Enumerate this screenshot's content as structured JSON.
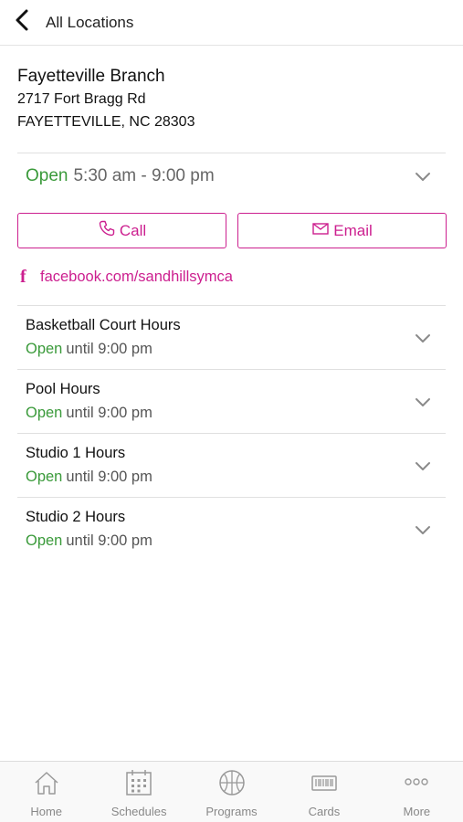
{
  "header": {
    "back_label": "All Locations"
  },
  "branch": {
    "name": "Fayetteville Branch",
    "address_line1": "2717 Fort Bragg Rd",
    "address_line2": "FAYETTEVILLE, NC 28303"
  },
  "hours": {
    "status": "Open",
    "range": "5:30 am - 9:00 pm"
  },
  "actions": {
    "call_label": "Call",
    "email_label": "Email"
  },
  "social": {
    "facebook_icon": "f",
    "facebook_text": "facebook.com/sandhillsymca"
  },
  "facilities": [
    {
      "name": "Basketball Court Hours",
      "status": "Open",
      "detail": "until 9:00 pm"
    },
    {
      "name": "Pool Hours",
      "status": "Open",
      "detail": "until 9:00 pm"
    },
    {
      "name": "Studio 1 Hours",
      "status": "Open",
      "detail": "until 9:00 pm"
    },
    {
      "name": "Studio 2 Hours",
      "status": "Open",
      "detail": "until 9:00 pm"
    }
  ],
  "tabbar": [
    {
      "label": "Home",
      "icon": "home-icon"
    },
    {
      "label": "Schedules",
      "icon": "calendar-icon"
    },
    {
      "label": "Programs",
      "icon": "basketball-icon"
    },
    {
      "label": "Cards",
      "icon": "card-icon"
    },
    {
      "label": "More",
      "icon": "more-icon"
    }
  ],
  "colors": {
    "accent": "#cc1f8f",
    "open_green": "#3a9a3a",
    "text_gray": "#666666"
  }
}
